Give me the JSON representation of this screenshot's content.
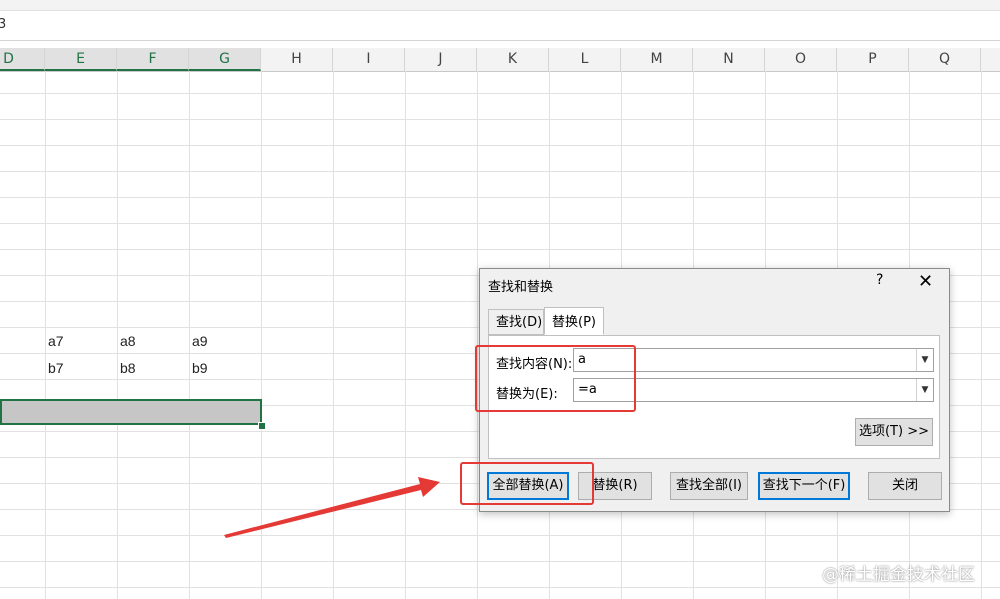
{
  "formula_bar": {
    "ref_fragment": "3"
  },
  "columns": [
    "D",
    "E",
    "F",
    "G",
    "H",
    "I",
    "J",
    "K",
    "L",
    "M",
    "N",
    "O",
    "P",
    "Q"
  ],
  "selected_columns": [
    "D",
    "E",
    "F",
    "G"
  ],
  "cells": {
    "row_a": [
      "a7",
      "a8",
      "a9"
    ],
    "row_b": [
      "b7",
      "b8",
      "b9"
    ]
  },
  "dialog": {
    "title": "查找和替换",
    "help": "?",
    "close": "✕",
    "tabs": [
      "查找(D)",
      "替换(P)"
    ],
    "active_tab": "替换(P)",
    "find_label": "查找内容(N):",
    "find_value": "a",
    "replace_label": "替换为(E):",
    "replace_value": "=a",
    "options_button": "选项(T) >>",
    "buttons": {
      "replace_all": "全部替换(A)",
      "replace": "替换(R)",
      "find_all": "查找全部(I)",
      "find_next": "查找下一个(F)",
      "close": "关闭"
    }
  },
  "annotation": {
    "color": "#e53935"
  },
  "watermark": "@稀土掘金技术社区",
  "colors": {
    "excel_green": "#217346",
    "focus_blue": "#0078d7"
  }
}
